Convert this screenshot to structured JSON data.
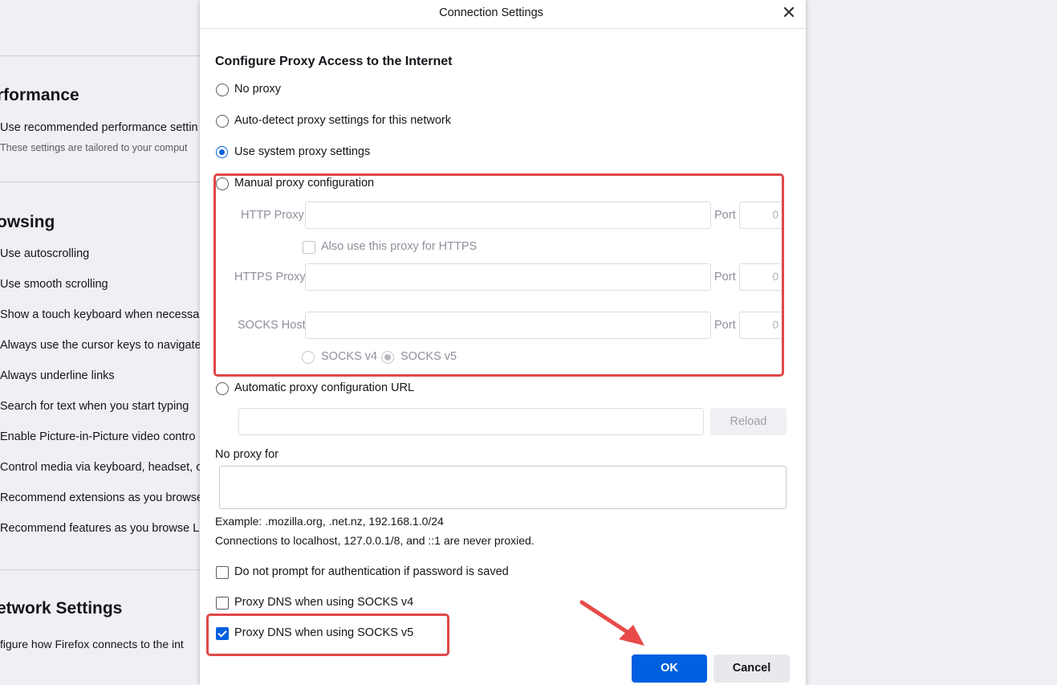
{
  "background": {
    "performance_heading": "rformance",
    "performance_option": "Use recommended performance settin",
    "performance_note": "These settings are tailored to your comput",
    "browsing_heading": "owsing",
    "browsing_items": [
      "Use autoscrolling",
      "Use smooth scrolling",
      "Show a touch keyboard when necessa",
      "Always use the cursor keys to navigate",
      "Always underline links",
      "Search for text when you start typing",
      "Enable Picture-in-Picture video contro",
      "Control media via keyboard, headset, o",
      "Recommend extensions as you browse",
      "Recommend features as you browse  L"
    ],
    "network_heading": "etwork Settings",
    "network_note": "figure how Firefox connects to the int"
  },
  "dialog": {
    "title": "Connection Settings",
    "close_glyph": "✕",
    "heading": "Configure Proxy Access to the Internet",
    "options": {
      "no_proxy": "No proxy",
      "auto_detect": "Auto-detect proxy settings for this network",
      "system": "Use system proxy settings",
      "manual": "Manual proxy configuration",
      "auto_url": "Automatic proxy configuration URL"
    },
    "selected_option": "system",
    "manual": {
      "http_label": "HTTP Proxy",
      "https_label": "HTTPS Proxy",
      "socks_label": "SOCKS Host",
      "port_label": "Port",
      "http_port": "0",
      "https_port": "0",
      "socks_port": "0",
      "also_https": "Also use this proxy for HTTPS",
      "socks_v4": "SOCKS v4",
      "socks_v5": "SOCKS v5"
    },
    "reload_label": "Reload",
    "no_proxy_for_label": "No proxy for",
    "example": "Example: .mozilla.org, .net.nz, 192.168.1.0/24",
    "localhost_note": "Connections to localhost, 127.0.0.1/8, and ::1 are never proxied.",
    "checkboxes": {
      "no_prompt": "Do not prompt for authentication if password is saved",
      "dns_v4": "Proxy DNS when using SOCKS v4",
      "dns_v5": "Proxy DNS when using SOCKS v5"
    },
    "dns_v5_checked": true,
    "ok_label": "OK",
    "cancel_label": "Cancel"
  },
  "colors": {
    "accent": "#0060df",
    "highlight": "#e04848"
  }
}
